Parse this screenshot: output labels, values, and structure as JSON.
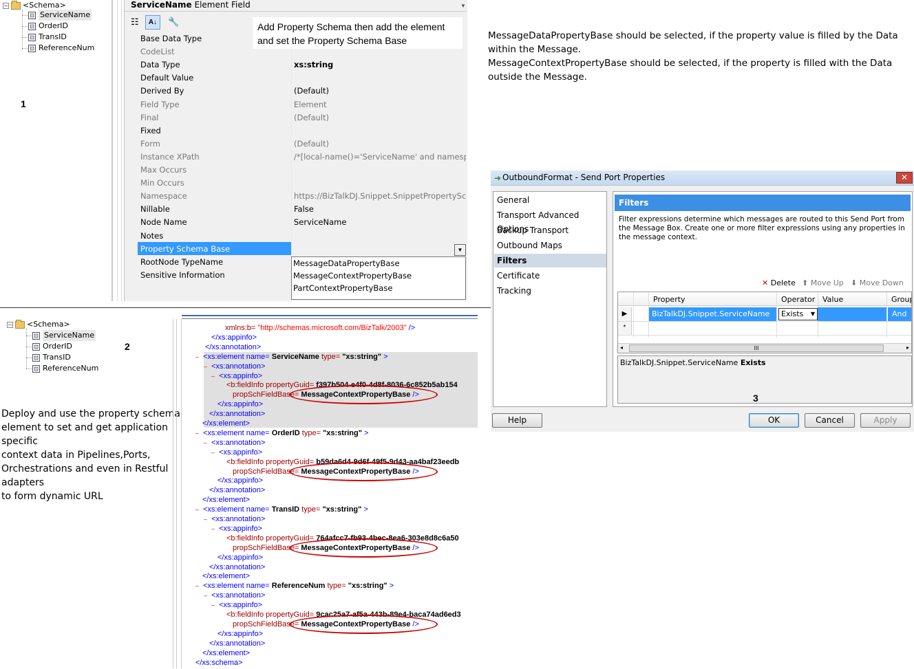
{
  "panel1": {
    "tree": {
      "root": "<Schema>",
      "nodes": [
        "ServiceName",
        "OrderID",
        "TransID",
        "ReferenceNum"
      ]
    },
    "title_bold": "ServiceName",
    "title_rest": "Element Field",
    "label": "1",
    "callout": "Add Property Schema then add the element and set the Property Schema Base",
    "properties": [
      {
        "name": "Base Data Type",
        "value": "",
        "gray": false
      },
      {
        "name": "CodeList",
        "value": "",
        "gray": true
      },
      {
        "name": "Data Type",
        "value": "xs:string",
        "gray": false,
        "bold_value": true
      },
      {
        "name": "Default Value",
        "value": "",
        "gray": false
      },
      {
        "name": "Derived By",
        "value": "(Default)",
        "gray": false
      },
      {
        "name": "Field Type",
        "value": "Element",
        "gray": true
      },
      {
        "name": "Final",
        "value": "(Default)",
        "gray": true
      },
      {
        "name": "Fixed",
        "value": "",
        "gray": false
      },
      {
        "name": "Form",
        "value": "(Default)",
        "gray": true
      },
      {
        "name": "Instance XPath",
        "value": "/*[local-name()='ServiceName' and namespace",
        "gray": true
      },
      {
        "name": "Max Occurs",
        "value": "",
        "gray": true
      },
      {
        "name": "Min Occurs",
        "value": "",
        "gray": true
      },
      {
        "name": "Namespace",
        "value": "https://BizTalkDJ.Snippet.SnippetPropertySchen",
        "gray": true
      },
      {
        "name": "Nillable",
        "value": "False",
        "gray": false
      },
      {
        "name": "Node Name",
        "value": "ServiceName",
        "gray": false
      },
      {
        "name": "Notes",
        "value": "",
        "gray": false
      },
      {
        "name": "Property Schema Base",
        "value": "",
        "gray": false,
        "selected": true
      },
      {
        "name": "RootNode TypeName",
        "value": "",
        "gray": false
      },
      {
        "name": "Sensitive Information",
        "value": "",
        "gray": false
      }
    ],
    "dropdown_options": [
      "MessageDataPropertyBase",
      "MessageContextPropertyBase",
      "PartContextPropertyBase"
    ]
  },
  "notes_top_right": [
    "MessageDataPropertyBase should be selected, if the property value is filled by the Data",
    "within the Message.",
    "MessageContextPropertyBase should be selected, if the property is filled with the Data",
    "outside the Message."
  ],
  "panel2": {
    "tree": {
      "root": "<Schema>",
      "nodes": [
        "ServiceName",
        "OrderID",
        "TransID",
        "ReferenceNum"
      ]
    },
    "label": "2",
    "description": [
      "Deploy and use the property schema",
      "element to set and get application specific",
      "context data in Pipelines,Ports,",
      "Orchestrations and even in Restful adapters",
      "to form dynamic URL"
    ],
    "xml_first_line_attr": "xmlns:b=",
    "xml_first_line_val": "\"http://schemas.microsoft.com/BizTalk/2003\"",
    "elements": [
      {
        "name": "ServiceName",
        "guid": "f397b504-e4f0-4d8f-8036-6c852b5ab154",
        "base": "MessageContextPropertyBase"
      },
      {
        "name": "OrderID",
        "guid": "b59da6d4-9d6f-49f5-9d43-aa4baf23eedb",
        "base": "MessageContextPropertyBase"
      },
      {
        "name": "TransID",
        "guid": "764afcc7-fb93-4bec-8ea6-303e8d8c6a50",
        "base": "MessageContextPropertyBase"
      },
      {
        "name": "ReferenceNum",
        "guid": "9cac25a7-af5a-443b-89e4-baca74ad6ed3",
        "base": "MessageContextPropertyBase"
      }
    ],
    "xml_tokens": {
      "appinfo_close": "</xs:appinfo>",
      "annotation_close": "</xs:annotation>",
      "element_open": "<xs:element name=",
      "type_attr": "type=",
      "type_val": "\"xs:string\"",
      "annotation_open": "<xs:annotation>",
      "appinfo_open": "<xs:appinfo>",
      "fieldinfo": "<b:fieldInfo propertyGuid=",
      "propschbase": "propSchFieldBase=",
      "self_close": "/>",
      "element_close": "</xs:element>",
      "schema_close": "</xs:schema>",
      "tag_end": ">",
      "minus": "–"
    }
  },
  "dialog": {
    "title": "OutboundFormat - Send Port Properties",
    "close_icon": "✕",
    "nav": [
      "General",
      "Transport Advanced Options",
      "Backup Transport",
      "Outbound Maps",
      "Filters",
      "Certificate",
      "Tracking"
    ],
    "active_nav": "Filters",
    "header": "Filters",
    "description": "Filter expressions determine which messages are routed to this Send Port from the Message Box. Create one or more filter expressions using any properties in the message context.",
    "toolbar": {
      "delete": "Delete",
      "move_up": "Move Up",
      "move_down": "Move Down"
    },
    "columns": [
      "Property",
      "Operator",
      "Value",
      "Group"
    ],
    "row": {
      "property": "BizTalkDJ.Snippet.ServiceName",
      "operator": "Exists",
      "value": "",
      "group": "And"
    },
    "new_row_marker": "*",
    "current_row_marker": "▶",
    "scroll_thumb": "III",
    "expression_prefix": "BizTalkDJ.Snippet.ServiceName",
    "expression_op": "Exists",
    "label": "3",
    "buttons": {
      "help": "Help",
      "ok": "OK",
      "cancel": "Cancel",
      "apply": "Apply"
    }
  }
}
